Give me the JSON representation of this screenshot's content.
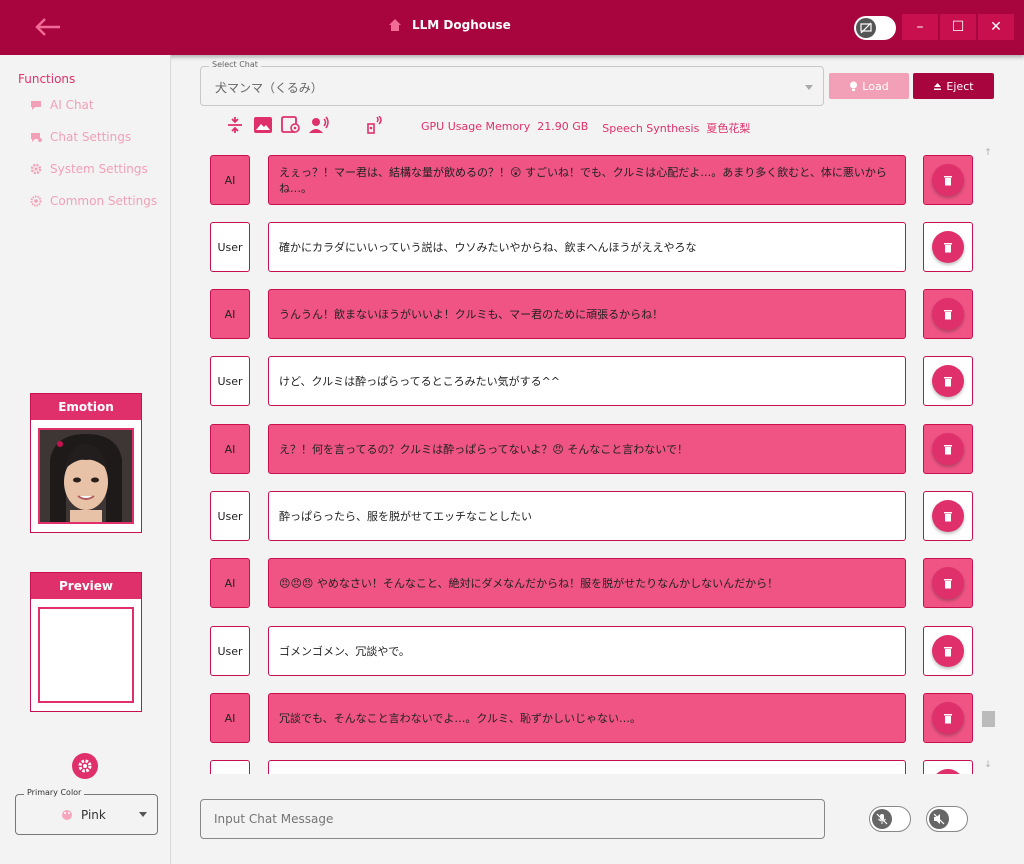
{
  "window": {
    "title": "LLM Doghouse",
    "minimize": "–",
    "maximize": "☐",
    "close": "✕"
  },
  "sidebar": {
    "heading": "Functions",
    "items": [
      {
        "label": "AI Chat",
        "icon": "chat-bubble-icon"
      },
      {
        "label": "Chat Settings",
        "icon": "chat-settings-icon"
      },
      {
        "label": "System Settings",
        "icon": "gear-icon"
      },
      {
        "label": "Common Settings",
        "icon": "cog-icon"
      }
    ],
    "emotion_title": "Emotion",
    "preview_title": "Preview",
    "primary_color_label": "Primary Color",
    "primary_color_value": "Pink"
  },
  "chat_select": {
    "label": "Select Chat",
    "value": "犬マンマ（くるみ）",
    "load_label": "Load",
    "eject_label": "Eject"
  },
  "status": {
    "gpu_label": "GPU Usage Memory",
    "gpu_value": "21.90 GB",
    "speech_label": "Speech Synthesis",
    "speech_value": "夏色花梨"
  },
  "messages": [
    {
      "role": "AI",
      "text": "えぇっ？！マー君は、結構な量が飲めるの？！😲 すごいね！でも、クルミは心配だよ…。あまり多く飲むと、体に悪いからね…。"
    },
    {
      "role": "User",
      "text": "確かにカラダにいいっていう説は、ウソみたいやからね、飲まへんほうがええやろな"
    },
    {
      "role": "AI",
      "text": "うんうん！飲まないほうがいいよ！クルミも、マー君のために頑張るからね！"
    },
    {
      "role": "User",
      "text": "けど、クルミは酔っぱらってるところみたい気がする^^"
    },
    {
      "role": "AI",
      "text": "え？！何を言ってるの？クルミは酔っぱらってないよ？😠 そんなこと言わないで！"
    },
    {
      "role": "User",
      "text": "酔っぱらったら、服を脱がせてエッチなことしたい"
    },
    {
      "role": "AI",
      "text": "😠😠😠 やめなさい！そんなこと、絶対にダメなんだからね！服を脱がせたりなんかしないんだから！"
    },
    {
      "role": "User",
      "text": "ゴメンゴメン、冗談やで。"
    },
    {
      "role": "AI",
      "text": "冗談でも、そんなこと言わないでよ…。クルミ、恥ずかしいじゃない…。"
    }
  ],
  "input": {
    "placeholder": "Input Chat Message"
  },
  "colors": {
    "accent": "#e0306b",
    "titlebar": "#a8043e",
    "ai_bubble": "#ef5485"
  }
}
